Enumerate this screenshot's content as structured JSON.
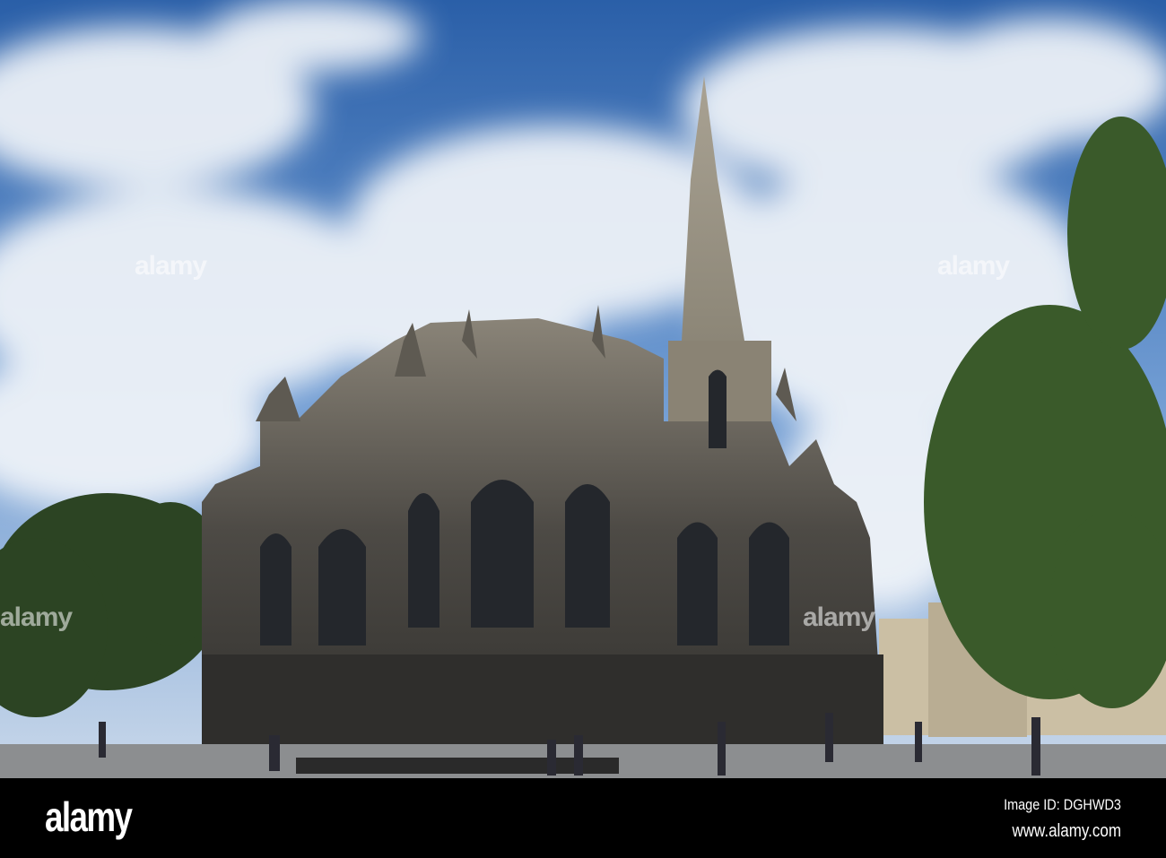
{
  "photo": {
    "subject": "Cathedral with spire under cloudy sky",
    "colors": {
      "sky_top": "#2f66b0",
      "sky_low": "#8fb2dc",
      "stone": "#4a4844",
      "tree": "#2f4a22",
      "plaza": "#8c8e90"
    }
  },
  "watermark": {
    "text": "alamy"
  },
  "footer": {
    "logo": "alamy",
    "image_id": "Image ID: DGHWD3",
    "url": "www.alamy.com"
  }
}
